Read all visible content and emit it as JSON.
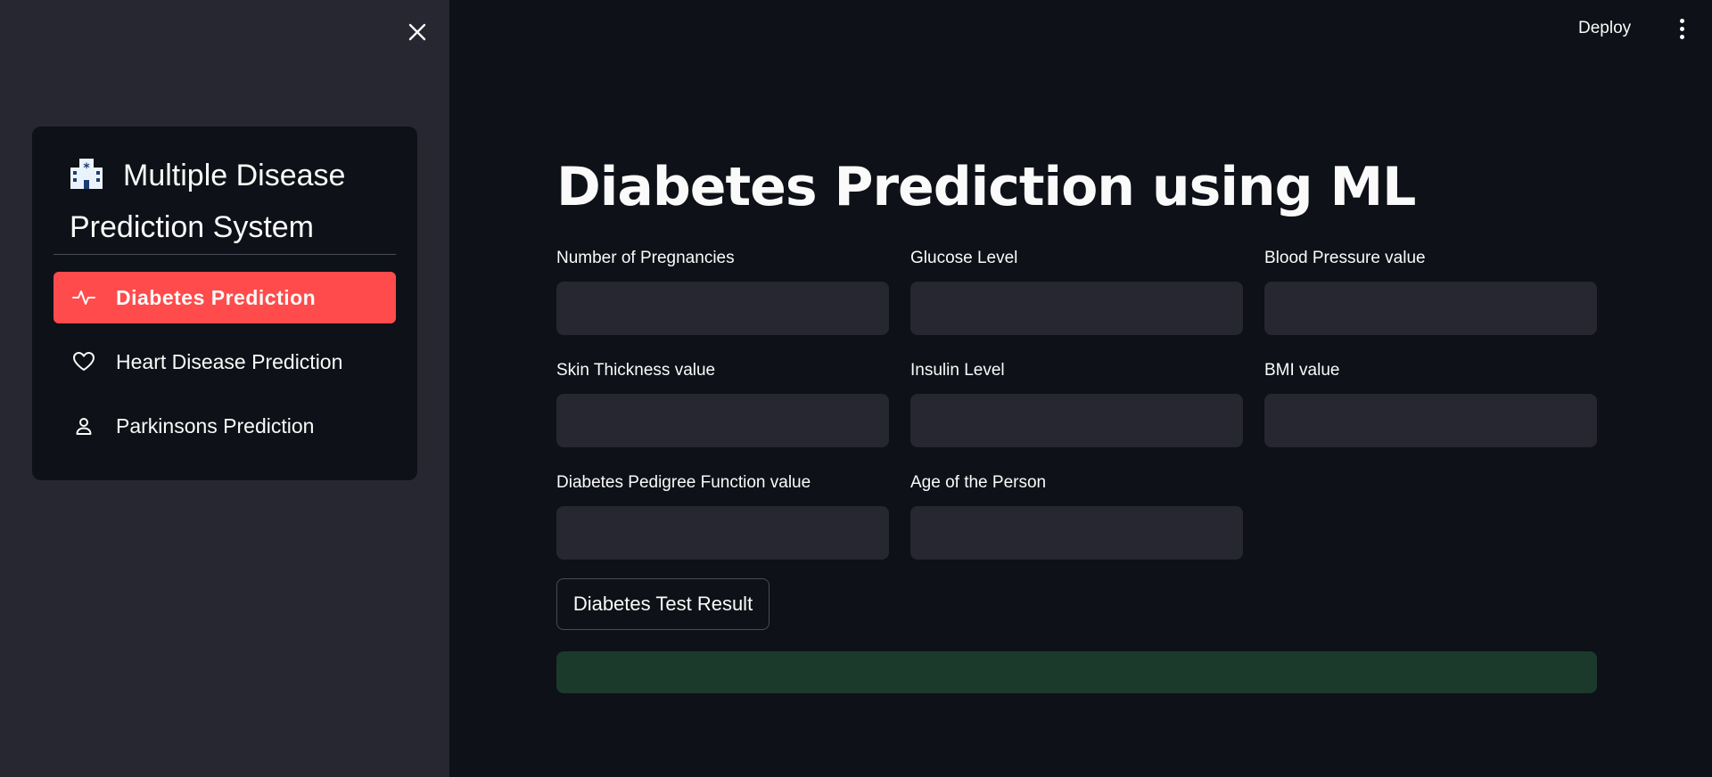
{
  "sidebar": {
    "title": "Multiple Disease Prediction System",
    "items": [
      {
        "label": "Diabetes Prediction",
        "icon": "activity-icon",
        "active": true
      },
      {
        "label": "Heart Disease Prediction",
        "icon": "heart-icon",
        "active": false
      },
      {
        "label": "Parkinsons Prediction",
        "icon": "person-icon",
        "active": false
      }
    ]
  },
  "header": {
    "deploy_label": "Deploy"
  },
  "main": {
    "title": "Diabetes Prediction using ML",
    "fields": [
      {
        "label": "Number of Pregnancies",
        "value": ""
      },
      {
        "label": "Glucose Level",
        "value": ""
      },
      {
        "label": "Blood Pressure value",
        "value": ""
      },
      {
        "label": "Skin Thickness value",
        "value": ""
      },
      {
        "label": "Insulin Level",
        "value": ""
      },
      {
        "label": "BMI value",
        "value": ""
      },
      {
        "label": "Diabetes Pedigree Function value",
        "value": ""
      },
      {
        "label": "Age of the Person",
        "value": ""
      }
    ],
    "submit_label": "Diabetes Test Result",
    "result_text": ""
  },
  "colors": {
    "accent": "#ff4b4b",
    "sidebar_bg": "#262730",
    "main_bg": "#0e1117",
    "input_bg": "#262730",
    "success_bg": "#1b3a2b"
  }
}
